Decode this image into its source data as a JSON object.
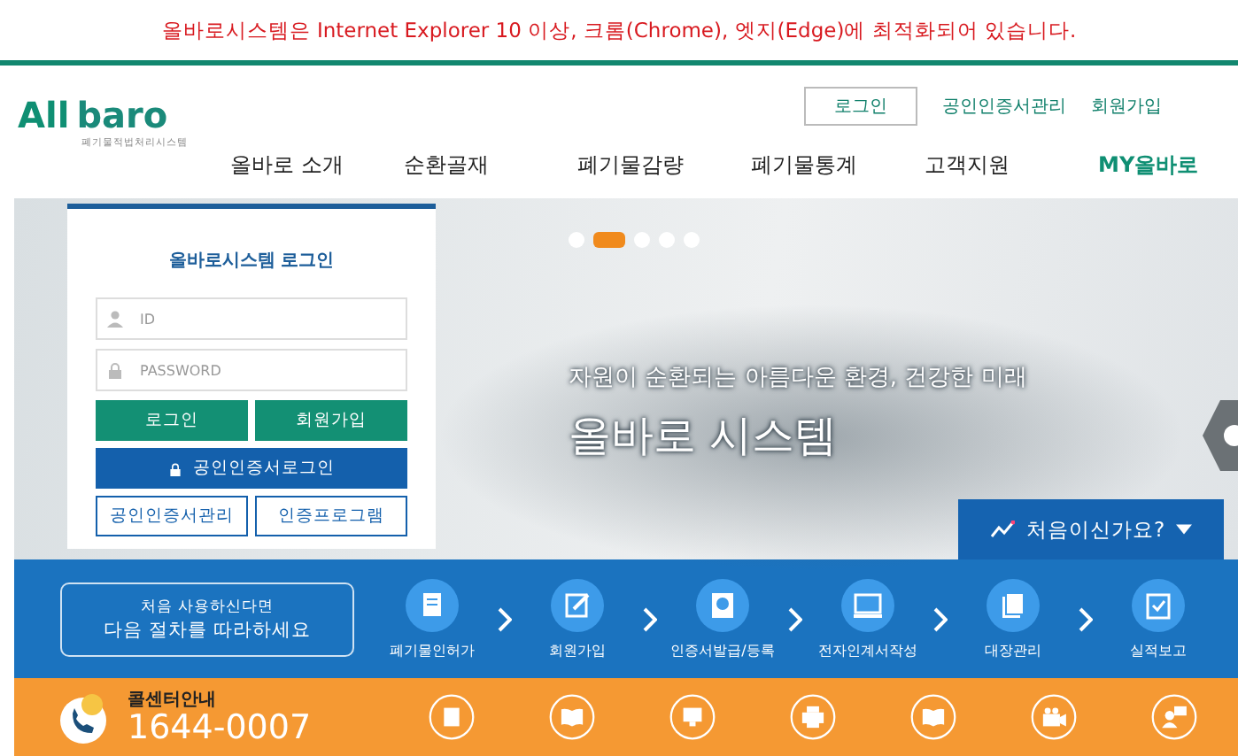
{
  "notice": "올바로시스템은 Internet Explorer 10 이상, 크롬(Chrome), 엣지(Edge)에 최적화되어 있습니다.",
  "header": {
    "logo": {
      "part_1": "All",
      "part_2": "baro",
      "tagline": "폐기물적법처리시스템"
    },
    "top_links": [
      {
        "label": "로그인",
        "kind": "button"
      },
      {
        "label": "공인인증서관리",
        "kind": "link"
      },
      {
        "label": "회원가입",
        "kind": "link"
      }
    ],
    "nav": [
      {
        "label": "올바로 소개",
        "accent": false
      },
      {
        "label": "순환골재",
        "accent": false
      },
      {
        "label": "폐기물감량",
        "accent": false
      },
      {
        "label": "폐기물통계",
        "accent": false
      },
      {
        "label": "고객지원",
        "accent": false
      },
      {
        "label": "MY올바로",
        "accent": true
      }
    ]
  },
  "login": {
    "title": "올바로시스템 로그인",
    "fields": [
      {
        "placeholder": "ID",
        "kind": "user"
      },
      {
        "placeholder": "PASSWORD",
        "kind": "lock"
      }
    ],
    "buttons": [
      {
        "label": "로그인",
        "kind": "green"
      },
      {
        "label": "회원가입",
        "kind": "green"
      },
      {
        "label": "공인인증서로그인",
        "kind": "blue"
      },
      {
        "label": "공인인증서관리",
        "kind": "outline"
      },
      {
        "label": "인증프로그램",
        "kind": "outline"
      }
    ]
  },
  "hero": {
    "dots": [
      {
        "selected": false
      },
      {
        "selected": true
      },
      {
        "selected": false
      },
      {
        "selected": false
      },
      {
        "selected": false
      }
    ],
    "subtitle": "자원이 순환되는 아름다운 환경, 건강한 미래",
    "title": "올바로 시스템",
    "first_time": "처음이신가요?"
  },
  "steps_band": {
    "intro_1": "처음 사용하신다면",
    "intro_2": "다음 절차를 따라하세요",
    "steps": [
      {
        "label": "폐기물인허가"
      },
      {
        "label": "회원가입"
      },
      {
        "label": "인증서발급/등록"
      },
      {
        "label": "전자인계서작성"
      },
      {
        "label": "대장관리"
      },
      {
        "label": "실적보고"
      }
    ]
  },
  "callcenter": {
    "label": "콜센터안내",
    "number": "1644-0007"
  }
}
